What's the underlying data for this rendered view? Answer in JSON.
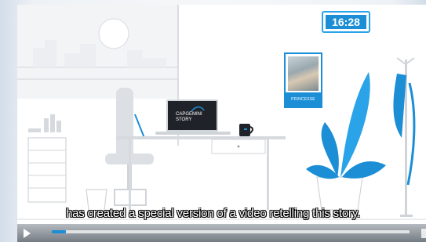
{
  "video": {
    "clock_time": "16:28",
    "photo_caption": "PRINCESSE",
    "laptop_line1": "CAPGEMINI",
    "laptop_line2": "STORY",
    "subtitle": "has created a special version of a video retelling this story.",
    "progress_percent": 4,
    "colors": {
      "accent": "#1b8ed6",
      "accent_light": "#2aa3e8",
      "line_gray": "#c8ccd1",
      "dark": "#1f2329"
    }
  },
  "icons": {
    "play": "play-icon",
    "progress": "progress-bar"
  }
}
